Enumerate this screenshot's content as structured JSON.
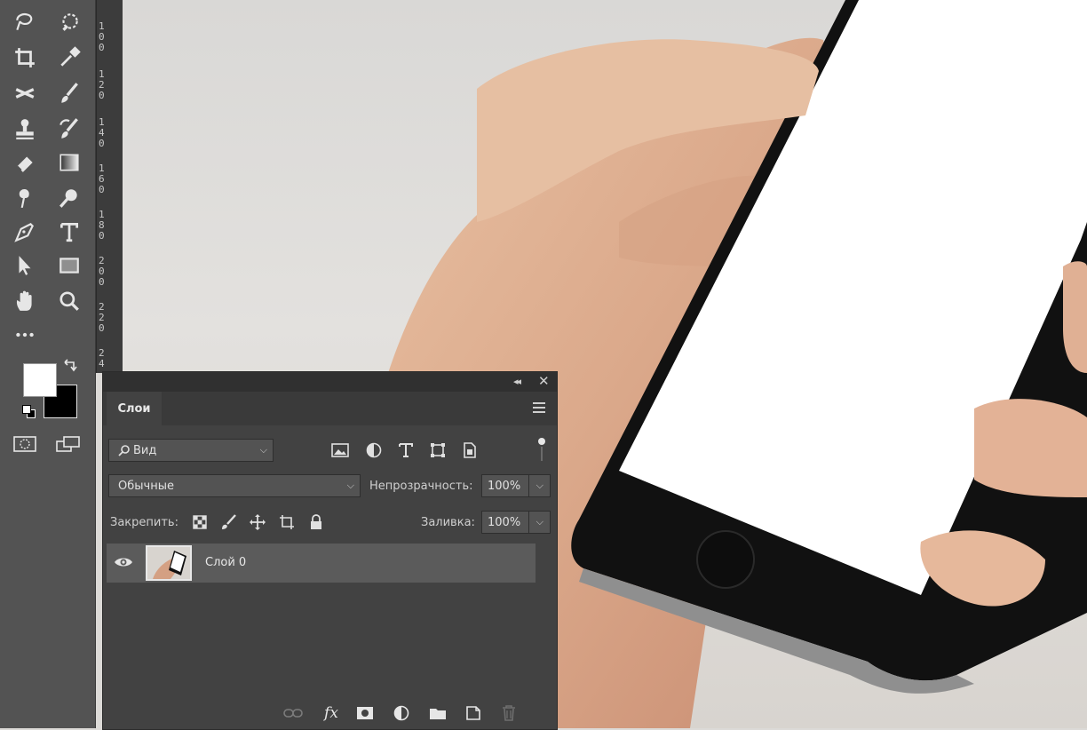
{
  "toolbar": {
    "tools": [
      "lasso-icon",
      "quick-selection-icon",
      "crop-icon",
      "eyedropper-icon",
      "healing-brush-icon",
      "brush-icon",
      "clone-stamp-icon",
      "history-brush-icon",
      "eraser-icon",
      "gradient-icon",
      "smudge-icon",
      "dodge-icon",
      "pen-icon",
      "type-icon",
      "path-selection-icon",
      "rectangle-icon",
      "hand-icon",
      "zoom-icon",
      "more-tools-icon"
    ],
    "foreground_color": "#ffffff",
    "background_color": "#000000"
  },
  "ruler": {
    "ticks": [
      "100",
      "120",
      "140",
      "160",
      "180",
      "200",
      "220",
      "24"
    ]
  },
  "layers_panel": {
    "tab_label": "Слои",
    "filter_label": "Вид",
    "blend_mode": "Обычные",
    "opacity_label": "Непрозрачность:",
    "opacity_value": "100%",
    "lock_label": "Закрепить:",
    "fill_label": "Заливка:",
    "fill_value": "100%",
    "layers": [
      {
        "name": "Слой 0",
        "visible": true
      }
    ],
    "bottom_icons": [
      "link-icon",
      "fx-icon",
      "mask-icon",
      "adjustment-icon",
      "group-icon",
      "new-layer-icon",
      "trash-icon"
    ]
  },
  "colors": {
    "panel_bg": "#424242",
    "toolbar_bg": "#535353"
  }
}
